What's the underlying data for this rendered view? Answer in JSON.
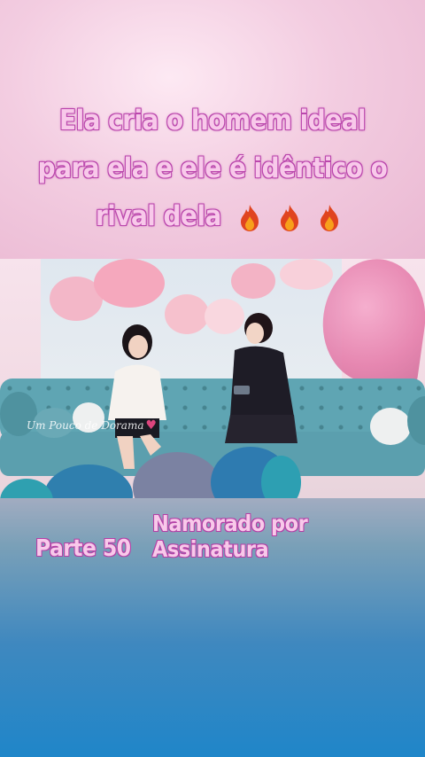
{
  "caption": {
    "line1": "Ela cria o homem ideal",
    "line2": "para ela e ele é idêntico o",
    "line3": "rival dela",
    "fire_icons": [
      "fire-icon",
      "fire-icon",
      "fire-icon"
    ]
  },
  "video": {
    "watermark": "Um Pouco de Dorama",
    "watermark_icon": "heart-icon"
  },
  "series_title": "Namorado por Assinatura",
  "part_label": "Parte 50",
  "colors": {
    "caption_fill": "#f8c9ea",
    "caption_outline": "#b43fa6",
    "sofa": "#5fa5b3"
  }
}
